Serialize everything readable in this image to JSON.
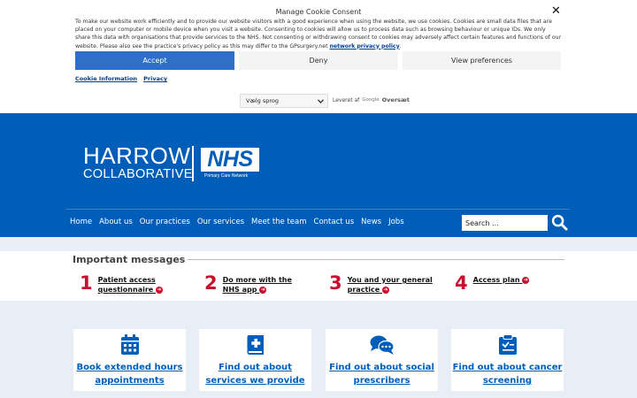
{
  "cookie": {
    "title": "Manage Cookie Consent",
    "close_label": "✕",
    "text_main": "To make our website work efficiently and to provide our website visitors with a good experience when using the website, we use cookies. Cookies are small data files that are placed on your computer or mobile device when you visit a website. Consenting to cookies will allow us to process data such as browsing behaviour or unique IDs. We only share this data with organisations that provide services to the NHS. Not consenting or withdrawing consent to cookies may adversely affect certain features and functions of our website. Please also see the practice's privacy policy as this may differ to the GPsurgery.net",
    "text_link": "network privacy policy",
    "text_end": ".",
    "accept_label": "Accept",
    "deny_label": "Deny",
    "prefs_label": "View preferences",
    "link_info": "Cookie Information",
    "link_privacy": "Privacy"
  },
  "translate": {
    "select_value": "Vælg sprog",
    "powered_by": "Leveret af",
    "google": "Google",
    "translate_word": "Oversæt"
  },
  "header": {
    "logo_line1": "HARROW",
    "logo_line2": "COLLABORATIVE",
    "nhs": "NHS",
    "nhs_sub": "Primary Care Network",
    "nav": [
      "Home",
      "About us",
      "Our practices",
      "Our services",
      "Meet the team",
      "Contact us",
      "News",
      "Jobs"
    ],
    "search_placeholder": "Search ..."
  },
  "messages": {
    "title": "Important messages",
    "items": [
      {
        "num": "1",
        "line1": "Patient access",
        "line2": "questionnaire"
      },
      {
        "num": "2",
        "line1": "Do more with the",
        "line2": "NHS app"
      },
      {
        "num": "3",
        "line1": "You and your general",
        "line2": "practice"
      },
      {
        "num": "4",
        "line1": "Access plan",
        "line2": ""
      }
    ]
  },
  "cards": [
    {
      "line1": "Book extended hours",
      "line2": "appointments",
      "icon": "calendar-icon"
    },
    {
      "line1": "Find out about",
      "line2": "services we provide",
      "icon": "medical-book-icon"
    },
    {
      "line1": "Find out about social",
      "line2": "prescribers",
      "icon": "chat-bubbles-icon"
    },
    {
      "line1": "Find out about cancer",
      "line2": "screening",
      "icon": "clipboard-icon"
    }
  ],
  "colors": {
    "nhs_blue": "#005eb8",
    "accent_red": "#c8102e",
    "accept_blue": "#2f6fc4"
  }
}
